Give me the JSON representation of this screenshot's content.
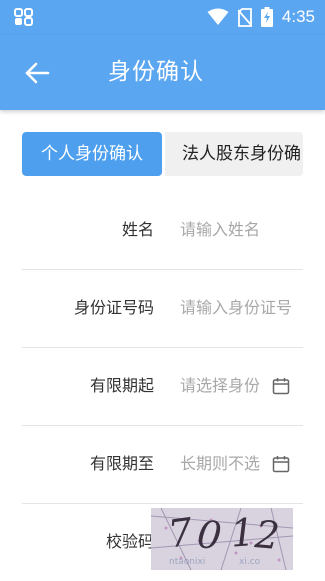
{
  "status_bar": {
    "time": "4:35",
    "icons": [
      "notification-app-icon",
      "wifi-icon",
      "no-sim-icon",
      "battery-charging-icon"
    ]
  },
  "header": {
    "title": "身份确认",
    "back_icon": "arrow-back-icon"
  },
  "tabs": [
    {
      "label": "个人身份确认",
      "active": true
    },
    {
      "label": "法人股东身份确",
      "active": false
    }
  ],
  "form": {
    "name": {
      "label": "姓名",
      "placeholder": "请输入姓名"
    },
    "id_number": {
      "label": "身份证号码",
      "placeholder": "请输入身份证号"
    },
    "valid_from": {
      "label": "有限期起",
      "placeholder": "请选择身份",
      "icon": "calendar-icon"
    },
    "valid_to": {
      "label": "有限期至",
      "placeholder": "长期则不选",
      "icon": "calendar-icon"
    },
    "captcha": {
      "label": "校验码",
      "image_text": "7012"
    }
  },
  "colors": {
    "primary": "#5aa6f1",
    "tab_active": "#4ea0ef",
    "tab_inactive": "#f0f0f0",
    "placeholder": "#a8a8a8",
    "label": "#333333",
    "divider": "#e4e4e4"
  }
}
